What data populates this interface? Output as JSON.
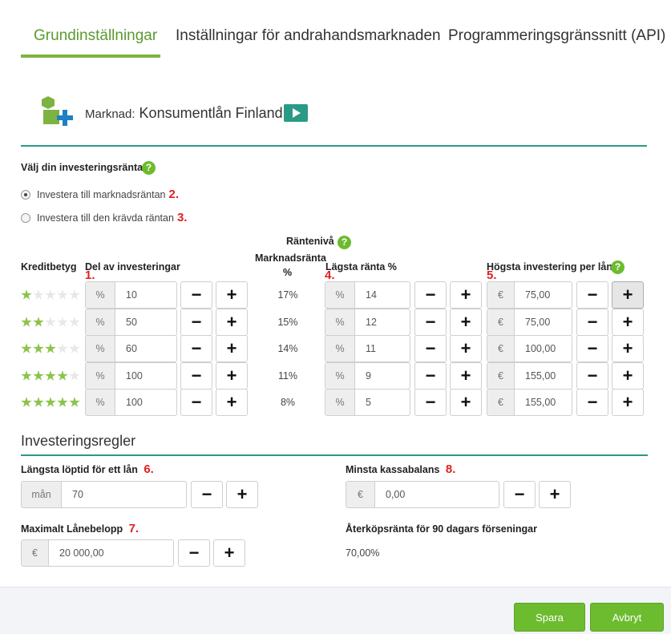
{
  "tabs": [
    {
      "label": "Grundinställningar"
    },
    {
      "label": "Inställningar för andrahandsmarknaden"
    },
    {
      "label": "Programmeringsgränssnitt (API)"
    }
  ],
  "market": {
    "prefix": "Marknad:",
    "name": "Konsumentlån Finland"
  },
  "investment_rate": {
    "title": "Välj din investeringsränta",
    "options": [
      {
        "label": "Investera till marknadsräntan",
        "marker": "2.",
        "checked": true
      },
      {
        "label": "Investera till den krävda räntan",
        "marker": "3.",
        "checked": false
      }
    ]
  },
  "table": {
    "rate_level": "Räntenivå",
    "headers": {
      "credit": "Kreditbetyg",
      "share": "Del av investeringar",
      "market_rate_1": "Marknadsränta",
      "market_rate_2": "%",
      "min_rate": "Lägsta ränta %",
      "max_invest": "Högsta investering per lån"
    },
    "markers": {
      "share": "1.",
      "min_rate": "4.",
      "max_invest": "5."
    },
    "addons": {
      "percent": "%",
      "euro": "€"
    },
    "minus": "−",
    "plus": "+",
    "rows": [
      {
        "stars": 1,
        "share": "10",
        "market_rate": "17%",
        "min_rate": "14",
        "max_invest": "75,00"
      },
      {
        "stars": 2,
        "share": "50",
        "market_rate": "15%",
        "min_rate": "12",
        "max_invest": "75,00"
      },
      {
        "stars": 3,
        "share": "60",
        "market_rate": "14%",
        "min_rate": "11",
        "max_invest": "100,00"
      },
      {
        "stars": 4,
        "share": "100",
        "market_rate": "11%",
        "min_rate": "9",
        "max_invest": "155,00"
      },
      {
        "stars": 5,
        "share": "100",
        "market_rate": "8%",
        "min_rate": "5",
        "max_invest": "155,00"
      }
    ]
  },
  "rules": {
    "title": "Investeringsregler",
    "max_duration": {
      "label": "Längsta löptid för ett lån",
      "marker": "6.",
      "addon": "mån",
      "value": "70"
    },
    "min_balance": {
      "label": "Minsta kassabalans",
      "marker": "8.",
      "addon": "€",
      "value": "0,00"
    },
    "max_loan": {
      "label": "Maximalt Lånebelopp",
      "marker": "7.",
      "addon": "€",
      "value": "20 000,00"
    },
    "buyback": {
      "label": "Återköpsränta för 90 dagars förseningar",
      "value": "70,00%"
    }
  },
  "footer": {
    "save": "Spara",
    "cancel": "Avbryt"
  },
  "help_icon": "?",
  "colors": {
    "accent": "#7cb342",
    "teal": "#2b9a85",
    "button": "#6dbb2f"
  }
}
